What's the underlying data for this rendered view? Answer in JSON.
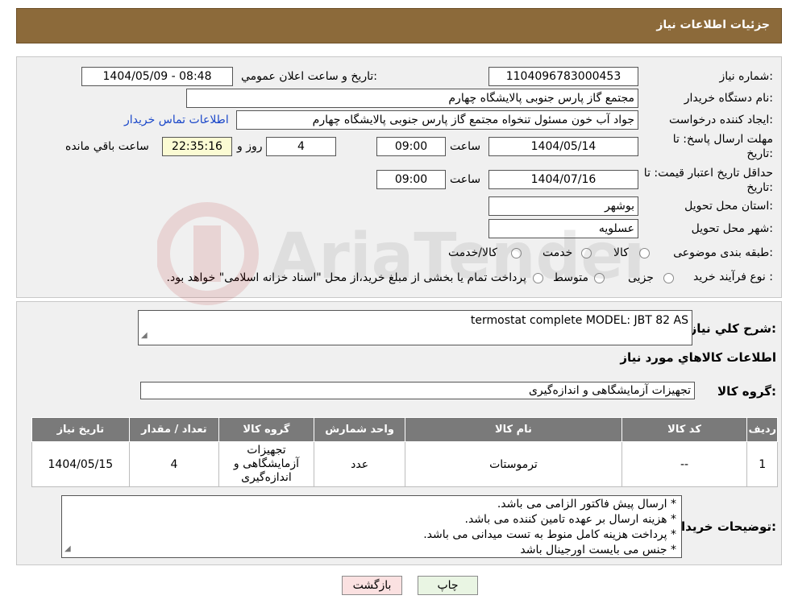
{
  "page_title": "جزئیات اطلاعات نیاز",
  "details": {
    "need_number_label": "شماره نیاز:",
    "need_number": "1104096783000453",
    "announce_label": "تاریخ و ساعت اعلان عمومي:",
    "announce_value": "1404/05/09 - 08:48",
    "buyer_org_label": "نام دستگاه خریدار:",
    "buyer_org": "مجتمع گاز پارس جنوبی  پالایشگاه چهارم",
    "requester_label": "ایجاد کننده درخواست:",
    "requester": "جواد آب خون مسئول تنخواه مجتمع گاز پارس جنوبی  پالایشگاه چهارم",
    "contact_link": "اطلاعات تماس خریدار",
    "deadline_label_1": "مهلت ارسال پاسخ: تا",
    "deadline_label_2": "تاریخ:",
    "deadline_date": "1404/05/14",
    "time_label": "ساعت",
    "deadline_time": "09:00",
    "days_value": "4",
    "days_label": "روز و",
    "remaining_time": "22:35:16",
    "remaining_label": "ساعت باقي مانده",
    "validity_label_1": "حداقل تاریخ اعتبار قیمت: تا",
    "validity_label_2": "تاریخ:",
    "validity_date": "1404/07/16",
    "validity_time": "09:00",
    "province_label": "استان محل تحویل:",
    "province": "بوشهر",
    "city_label": "شهر محل تحویل:",
    "city": "عسلویه",
    "category_label": "طبقه بندی موضوعی:",
    "category_options": [
      "کالا",
      "خدمت",
      "کالا/خدمت"
    ],
    "purchase_type_label": "نوع فرآیند خرید :",
    "purchase_options": [
      "جزیی",
      "متوسط"
    ],
    "purchase_note": "پرداخت تمام یا بخشی از مبلغ خرید،از محل \"اسناد خزانه اسلامی\" خواهد بود."
  },
  "summary": {
    "description_label": "شرح كلي نياز:",
    "description": "termostat  complete MODEL: JBT 82 AS",
    "items_heading": "اطلاعات كالاهاي مورد نياز",
    "group_label": "گروه کالا:",
    "group_value": "تجهیزات آزمایشگاهی و اندازه‌گیری"
  },
  "table": {
    "headers": [
      "ردیف",
      "کد کالا",
      "نام کالا",
      "واحد شمارش",
      "گروه کالا",
      "تعداد / مقدار",
      "تاریخ نیاز"
    ],
    "rows": [
      {
        "row": "1",
        "code": "--",
        "name": "ترموستات",
        "unit": "عدد",
        "group": "تجهیزات آزمایشگاهی و اندازه‌گیری",
        "qty": "4",
        "date": "1404/05/15"
      }
    ]
  },
  "notes": {
    "label": "توضیحات خریدار:",
    "lines": [
      "* ارسال پیش فاکتور الزامی می باشد.",
      "* هزینه ارسال بر عهده تامین کننده می باشد.",
      "* پرداخت هزینه کامل منوط به تست میدانی می باشد.",
      "* جنس می بایست اورجینال باشد"
    ]
  },
  "buttons": {
    "print": "چاپ",
    "back": "بازگشت"
  },
  "watermark_text": "AriaTender.neT"
}
